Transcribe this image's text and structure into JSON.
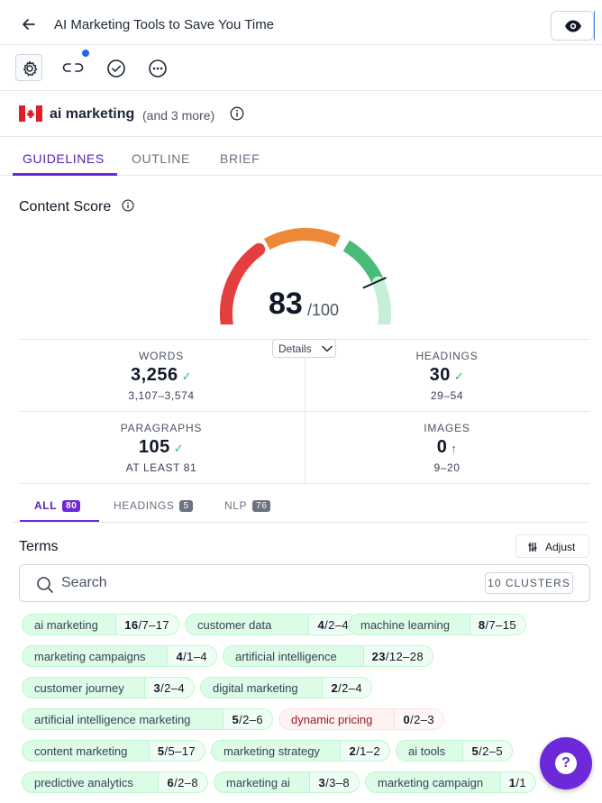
{
  "header": {
    "title": "AI Marketing Tools to Save You Time"
  },
  "keyword": {
    "main": "ai marketing",
    "more": "(and 3 more)"
  },
  "tabs": [
    {
      "label": "GUIDELINES"
    },
    {
      "label": "OUTLINE"
    },
    {
      "label": "BRIEF"
    }
  ],
  "content_score": {
    "title": "Content Score",
    "score": "83",
    "max": "/100",
    "score_fraction": 0.83,
    "details_label": "Details"
  },
  "metrics": {
    "words": {
      "label": "WORDS",
      "value": "3,256",
      "status": "✓",
      "range": "3,107–3,574"
    },
    "headings": {
      "label": "HEADINGS",
      "value": "30",
      "status": "✓",
      "range": "29–54"
    },
    "paragraphs": {
      "label": "PARAGRAPHS",
      "value": "105",
      "status": "✓",
      "range": "AT LEAST 81"
    },
    "images": {
      "label": "IMAGES",
      "value": "0",
      "status": "↑",
      "range": "9–20"
    }
  },
  "subtabs": [
    {
      "label": "ALL",
      "count": "80"
    },
    {
      "label": "HEADINGS",
      "count": "5"
    },
    {
      "label": "NLP",
      "count": "76"
    }
  ],
  "terms": {
    "title": "Terms",
    "adjust_label": "Adjust",
    "search_placeholder": "Search",
    "clusters_label": "10 CLUSTERS",
    "chips": [
      {
        "name": "ai marketing",
        "used": "16",
        "range": "/7–17"
      },
      {
        "name": "customer data",
        "used": "4",
        "range": "/2–4"
      },
      {
        "name": "machine learning",
        "used": "8",
        "range": "/7–15"
      },
      {
        "name": "marketing campaigns",
        "used": "4",
        "range": "/1–4"
      },
      {
        "name": "artificial intelligence",
        "used": "23",
        "range": "/12–28"
      },
      {
        "name": "customer journey",
        "used": "3",
        "range": "/2–4"
      },
      {
        "name": "digital marketing",
        "used": "2",
        "range": "/2–4"
      },
      {
        "name": "artificial intelligence marketing",
        "used": "5",
        "range": "/2–6"
      },
      {
        "name": "dynamic pricing",
        "used": "0",
        "range": "/2–3"
      },
      {
        "name": "content marketing",
        "used": "5",
        "range": "/5–17"
      },
      {
        "name": "marketing strategy",
        "used": "2",
        "range": "/1–2"
      },
      {
        "name": "ai tools",
        "used": "5",
        "range": "/2–5"
      },
      {
        "name": "predictive analytics",
        "used": "6",
        "range": "/2–8"
      },
      {
        "name": "marketing ai",
        "used": "3",
        "range": "/3–8"
      },
      {
        "name": "marketing campaign",
        "used": "1",
        "range": "/1"
      }
    ]
  },
  "help": {
    "label": "?"
  },
  "colors": {
    "accent": "#6d28d9",
    "gauge_red": "#e53e3e",
    "gauge_orange": "#ed8936",
    "gauge_green": "#48bb78",
    "gauge_light_green": "#c6f0d5"
  }
}
